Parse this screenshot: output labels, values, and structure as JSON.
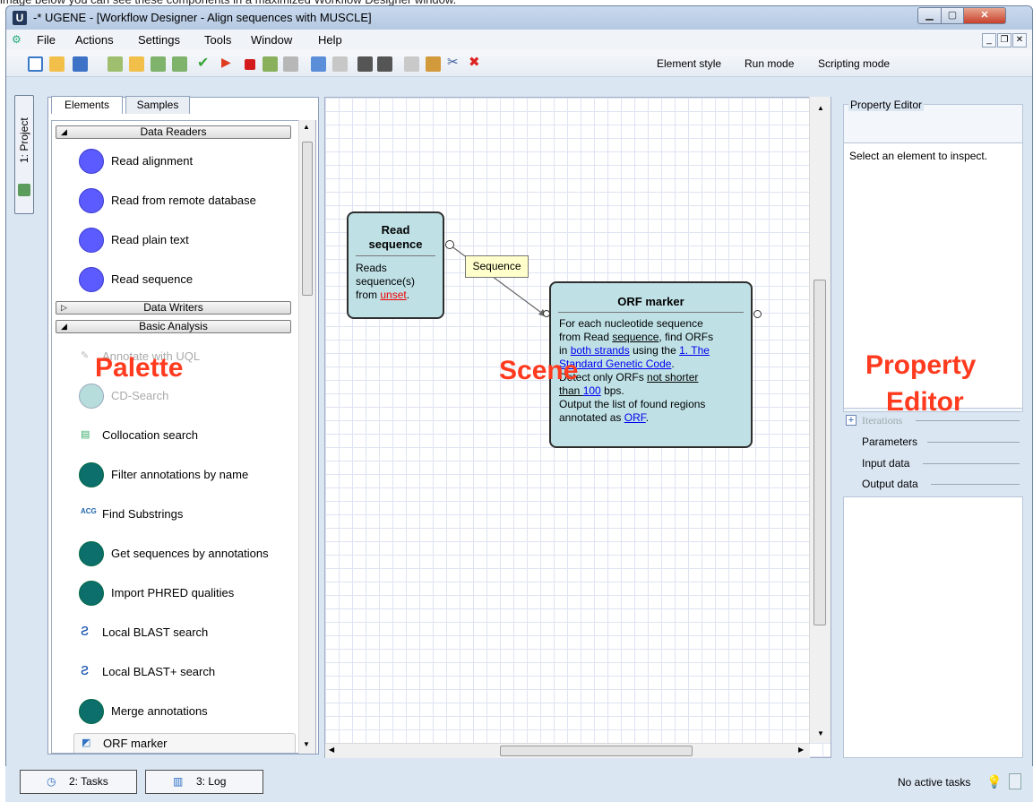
{
  "caption": "image below you can see these components in a maximized Workflow Designer window.",
  "window": {
    "icon_letter": "U",
    "title": "-* UGENE - [Workflow Designer - Align sequences with MUSCLE]"
  },
  "menu": [
    "File",
    "Actions",
    "Settings",
    "Tools",
    "Window",
    "Help"
  ],
  "toolbar": {
    "element_style": "Element style",
    "run_mode": "Run mode",
    "scripting_mode": "Scripting mode"
  },
  "sidebar": {
    "project_tab": "1: Project"
  },
  "palette": {
    "tabs": [
      "Elements",
      "Samples"
    ],
    "groups": {
      "readers": "Data Readers",
      "writers": "Data Writers",
      "basic": "Basic Analysis"
    },
    "readers": [
      "Read alignment",
      "Read from remote database",
      "Read plain text",
      "Read sequence"
    ],
    "basic": [
      "Annotate with UQL",
      "CD-Search",
      "Collocation search",
      "Filter annotations by name",
      "Find Substrings",
      "Get sequences by annotations",
      "Import PHRED qualities",
      "Local BLAST search",
      "Local BLAST+ search",
      "Merge annotations",
      "ORF marker"
    ]
  },
  "scene": {
    "read_node": {
      "title_line1": "Read",
      "title_line2": "sequence",
      "desc1": "Reads",
      "desc2": "sequence(s)",
      "desc3": "from ",
      "link": "unset",
      "end": "."
    },
    "link_label": "Sequence",
    "orf_node": {
      "title": "ORF marker",
      "l1": "For each nucleotide sequence",
      "l2a": "from Read ",
      "l2link": "sequence",
      "l2b": ", find ORFs",
      "l3a": "in ",
      "l3link": "both strands",
      "l3b": " using the ",
      "l3link2": "1. The",
      "l4link": "Standard Genetic Code",
      "l4b": ".",
      "l5a": "Detect only ORFs ",
      "l5link": "not shorter",
      "l6link": "than ",
      "l6num": "100",
      "l6b": " bps",
      ".": ".",
      "l7": "Output the list of found regions",
      "l8a": "annotated as ",
      "l8link": "ORF",
      "l8b": "."
    }
  },
  "annotations": {
    "palette": "Palette",
    "scene": "Scene",
    "prop1": "Property",
    "prop2": "Editor"
  },
  "property_editor": {
    "title": "Property Editor",
    "hint": "Select an element to inspect.",
    "iterations": "Iterations",
    "parameters": "Parameters",
    "input": "Input data",
    "output": "Output data"
  },
  "statusbar": {
    "tasks": "2: Tasks",
    "log": "3: Log",
    "status": "No active tasks"
  },
  "colors": {
    "reader_icon": "#5b5bff",
    "teal_icon": "#0c6f6b",
    "node_fill": "#bfe1e6",
    "annotation_red": "#ff3a1e"
  }
}
